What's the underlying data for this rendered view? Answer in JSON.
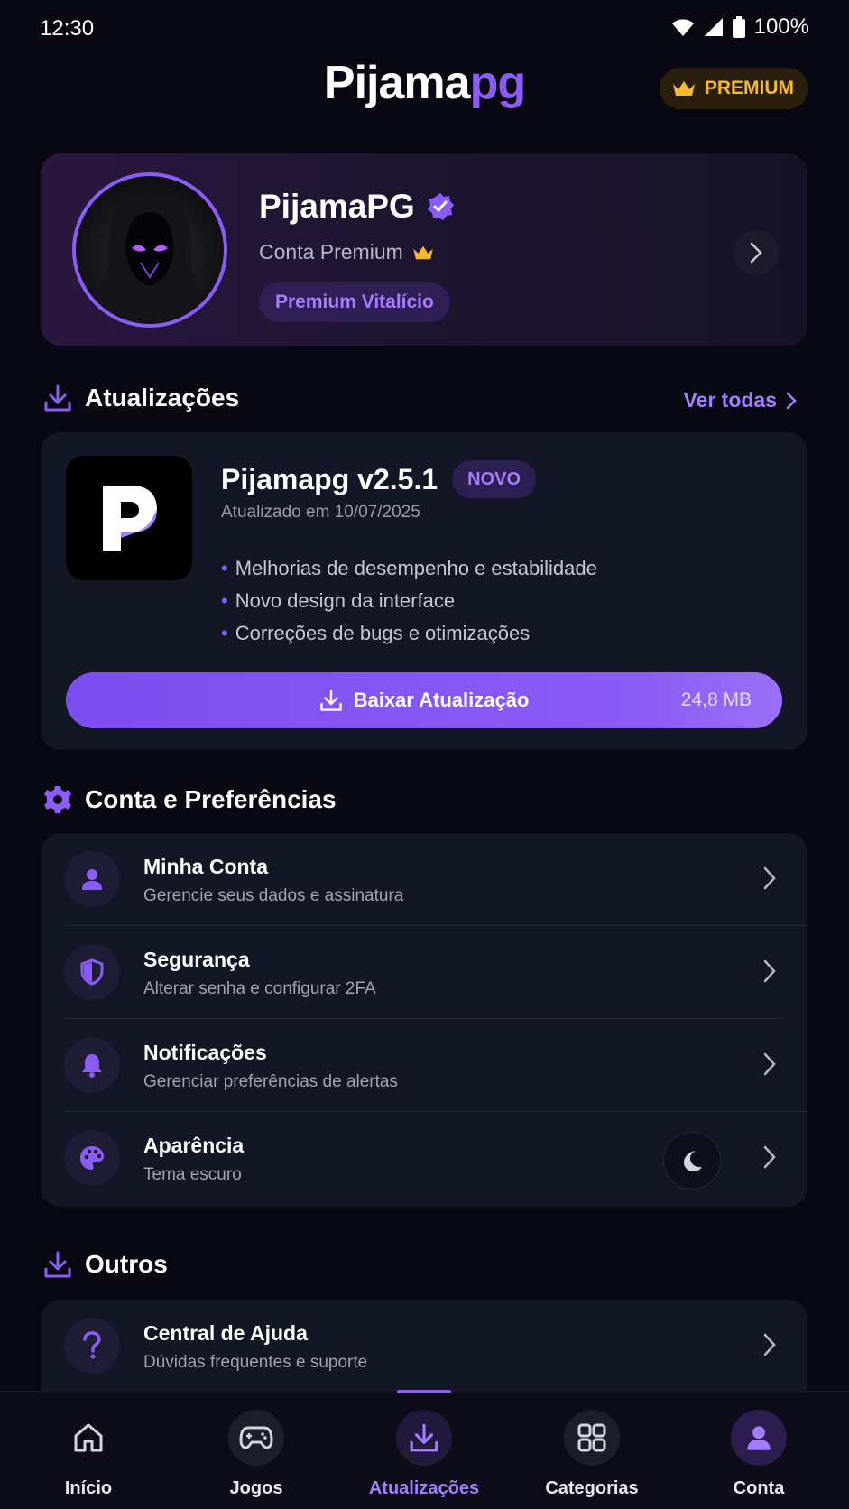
{
  "status_bar": {
    "time": "12:30",
    "battery": "100%"
  },
  "header": {
    "logo_main": "Pijama",
    "logo_accent": "pg",
    "premium_label": "PREMIUM"
  },
  "profile": {
    "name": "PijamaPG",
    "subtitle": "Conta Premium",
    "plan_badge": "Premium Vitalício"
  },
  "updates_section": {
    "title": "Atualizações",
    "see_all": "Ver todas",
    "update": {
      "app_title": "Pijamapg v2.5.1",
      "badge": "NOVO",
      "date": "Atualizado em 10/07/2025",
      "notes": [
        "Melhorias de desempenho e estabilidade",
        "Novo design da interface",
        "Correções de bugs e otimizações"
      ],
      "download_label": "Baixar Atualização",
      "size": "24,8 MB"
    }
  },
  "settings_section": {
    "title": "Conta e Preferências",
    "items": [
      {
        "title": "Minha Conta",
        "subtitle": "Gerencie seus dados e assinatura",
        "icon": "user-icon"
      },
      {
        "title": "Segurança",
        "subtitle": "Alterar senha e configurar 2FA",
        "icon": "shield-icon"
      },
      {
        "title": "Notificações",
        "subtitle": "Gerenciar preferências de alertas",
        "icon": "bell-icon"
      },
      {
        "title": "Aparência",
        "subtitle": "Tema escuro",
        "icon": "palette-icon"
      }
    ]
  },
  "others_section": {
    "title": "Outros",
    "items": [
      {
        "title": "Central de Ajuda",
        "subtitle": "Dúvidas frequentes e suporte",
        "icon": "help-icon"
      }
    ]
  },
  "bottom_nav": {
    "items": [
      {
        "label": "Início",
        "icon": "home-icon"
      },
      {
        "label": "Jogos",
        "icon": "gamepad-icon"
      },
      {
        "label": "Atualizações",
        "icon": "download-icon"
      },
      {
        "label": "Categorias",
        "icon": "grid-icon"
      },
      {
        "label": "Conta",
        "icon": "user-icon"
      }
    ],
    "active_index": 2
  },
  "colors": {
    "background": "#070812",
    "accent": "#8b5cf6",
    "premium_gold": "#f6b92b",
    "card": "#131624"
  }
}
